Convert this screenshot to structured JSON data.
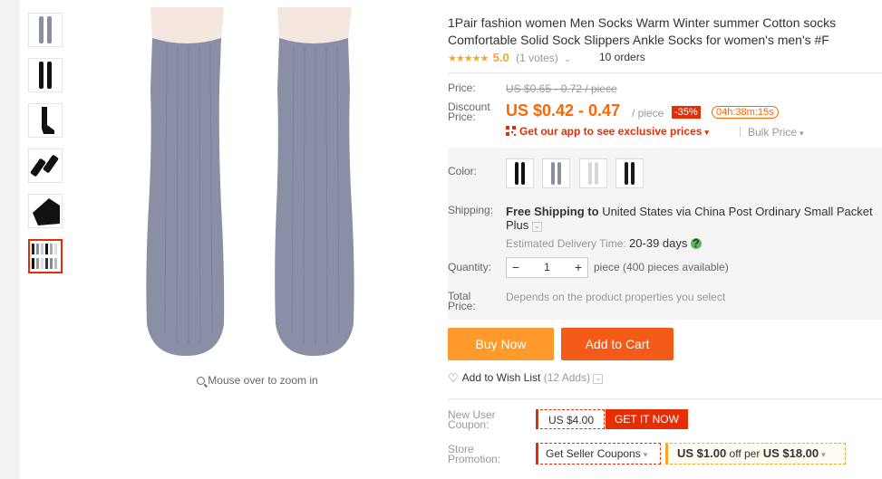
{
  "product": {
    "title": "1Pair fashion women Men Socks Warm Winter summer Cotton socks Comfortable Solid Sock Slippers Ankle Socks for women's men's #F",
    "stars": "★★★★★",
    "score": "5.0",
    "votes": "(1 votes)",
    "orders": "10 orders"
  },
  "price": {
    "label": "Price:",
    "original": "US $0.65 - 0.72 / piece",
    "discount_label_1": "Discount",
    "discount_label_2": "Price:",
    "discount": "US $0.42 - 0.47",
    "per_piece": "/ piece",
    "off_badge": "-35%",
    "timer": "04h:38m:15s",
    "app_promo": "Get our app to see exclusive prices",
    "bulk": "Bulk Price"
  },
  "sku": {
    "color_label": "Color:",
    "shipping_label": "Shipping:",
    "shipping_bold": "Free Shipping to",
    "shipping_rest": "United States via China Post Ordinary Small Packet Plus",
    "est_label": "Estimated Delivery Time:",
    "est_value": "20-39 days",
    "quantity_label": "Quantity:",
    "qty_minus": "−",
    "qty_value": "1",
    "qty_plus": "+",
    "qty_info": "piece (400 pieces available)",
    "total_label_1": "Total",
    "total_label_2": "Price:",
    "total_note": "Depends on the product properties you select"
  },
  "actions": {
    "buy_now": "Buy Now",
    "add_to_cart": "Add to Cart",
    "wish": "Add to Wish List",
    "wish_count": "(12 Adds)"
  },
  "coupons": {
    "new_user_label_1": "New User",
    "new_user_label_2": "Coupon:",
    "new_user_value": "US $4.00",
    "get_it_now": "GET IT NOW",
    "store_label_1": "Store",
    "store_label_2": "Promotion:",
    "seller_coupons": "Get Seller Coupons",
    "deal_amount": "US $1.00",
    "deal_mid": "off per",
    "deal_threshold": "US $18.00"
  },
  "gallery": {
    "zoom_hint": "Mouse over to zoom in"
  },
  "colors": {
    "accent": "#e62e04",
    "orange": "#ff6600",
    "buy_now_bg": "#ff9a2a",
    "cart_bg": "#f45b18"
  }
}
